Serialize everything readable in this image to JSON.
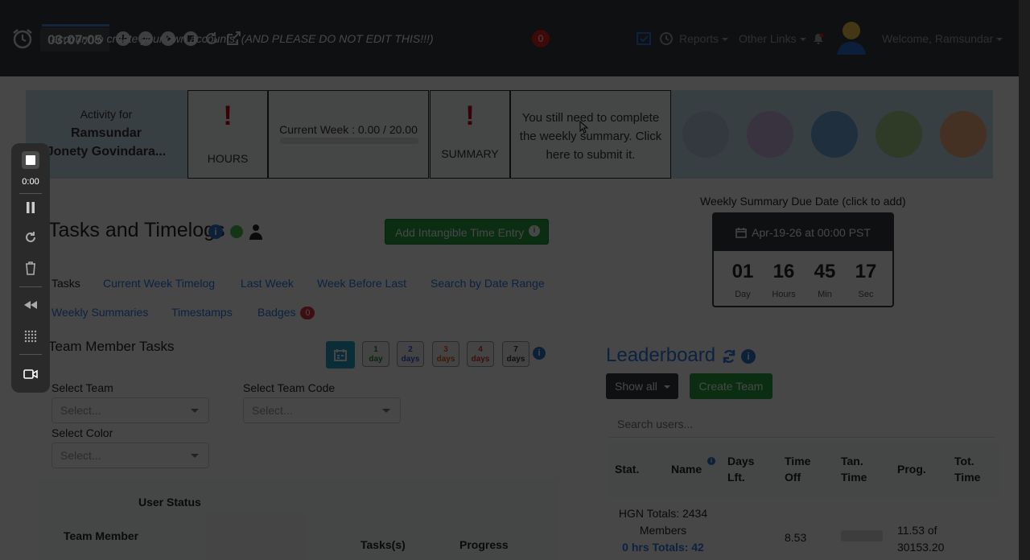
{
  "navbar": {
    "banner": "account to create your own accounts. (AND PLEASE DO NOT EDIT THIS!!!)",
    "badge_count": "0",
    "reports": "Reports",
    "other_links": "Other Links",
    "welcome": "Welcome, Ramsundar"
  },
  "timer": {
    "display": "03:07:05"
  },
  "summary_bar": {
    "activity_label": "Activity for",
    "activity_name_line1": "Ramsundar",
    "activity_name_line2": "Jonety Govindara...",
    "hours_mark": "!",
    "hours_caption": "HOURS",
    "current_week": "Current Week : 0.00 / 20.00",
    "summary_mark": "!",
    "summary_caption": "SUMMARY",
    "weekly_summary_reminder": "You still need to complete the weekly summary. Click here to submit it."
  },
  "recorder": {
    "elapsed": "0:00"
  },
  "tasks": {
    "title": "Tasks and Timelogs",
    "add_intangible": "Add Intangible Time Entry",
    "tabs_row1": [
      "Tasks",
      "Current Week Timelog",
      "Last Week",
      "Week Before Last",
      "Search by Date Range"
    ],
    "tabs_row2": [
      "Weekly Summaries",
      "Timestamps",
      "Badges"
    ],
    "badges_count": "0",
    "team_member_tasks": "Team Member Tasks",
    "day_buttons": [
      {
        "num": "1",
        "unit": "day",
        "color": "#2e7d32"
      },
      {
        "num": "2",
        "unit": "days",
        "color": "#3b5bdb"
      },
      {
        "num": "3",
        "unit": "days",
        "color": "#e8590c"
      },
      {
        "num": "4",
        "unit": "days",
        "color": "#e03131"
      },
      {
        "num": "7",
        "unit": "days",
        "color": "#343a40"
      }
    ],
    "select_team_label": "Select Team",
    "select_team_placeholder": "Select...",
    "select_team_code_label": "Select Team Code",
    "select_team_code_placeholder": "Select...",
    "select_color_label": "Select Color",
    "select_color_placeholder": "Select...",
    "user_status": "User Status",
    "col_team_member": "Team Member",
    "col_tasks": "Tasks(s)",
    "col_progress": "Progress"
  },
  "due": {
    "label": "Weekly Summary Due Date (click to add)",
    "date": "Apr-19-26 at 00:00 PST",
    "units": [
      {
        "value": "01",
        "unit": "Day"
      },
      {
        "value": "16",
        "unit": "Hours"
      },
      {
        "value": "45",
        "unit": "Min"
      },
      {
        "value": "17",
        "unit": "Sec"
      }
    ]
  },
  "leaderboard": {
    "title": "Leaderboard",
    "show_all": "Show all",
    "create_team": "Create Team",
    "search_placeholder": "Search users...",
    "headers": {
      "stat": "Stat.",
      "name": "Name",
      "days_left_1": "Days",
      "days_left_2": "Lft.",
      "time_off_1": "Time",
      "time_off_2": "Off",
      "tan_time_1": "Tan.",
      "tan_time_2": "Time",
      "prog": "Prog.",
      "tot_time_1": "Tot.",
      "tot_time_2": "Time"
    },
    "totals_line1": "HGN Totals: 2434",
    "totals_line2": "Members",
    "totals_line3": "0 hrs Totals: 42",
    "time_off_value": "8.53",
    "prog_line1": "11.53 of",
    "prog_line2": "30153.20"
  }
}
